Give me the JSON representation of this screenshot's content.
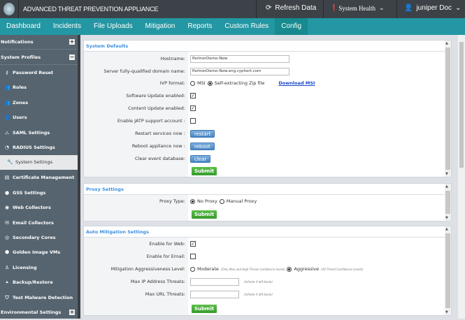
{
  "header": {
    "title": "ADVANCED THREAT PREVENTION APPLIANCE",
    "refresh": "Refresh Data",
    "health": "System Health",
    "user": "juniper Doc"
  },
  "nav": [
    "Dashboard",
    "Incidents",
    "File Uploads",
    "Mitigation",
    "Reports",
    "Custom Rules",
    "Config"
  ],
  "sidebar": {
    "notifications": "Notifications",
    "system_profiles": "System Profiles",
    "environmental": "Environmental Settings",
    "items": [
      "Password Reset",
      "Roles",
      "Zones",
      "Users",
      "SAML Settings",
      "RADIUS Settings",
      "System Settings",
      "Certificate Management",
      "GSS Settings",
      "Web Collectors",
      "Email Collectors",
      "Secondary Cores",
      "Golden Image VMs",
      "Licensing",
      "Backup/Restore",
      "Test Malware Detection"
    ]
  },
  "system_defaults": {
    "title": "System Defaults",
    "hostname_label": "Hostname:",
    "hostname": "PartnerDemo-New",
    "fqdn_label": "Server fully-qualified domain name:",
    "fqdn": "PartnerDemo-New.eng.cyphort.com",
    "ivp_label": "IVP format:",
    "ivp_msi": "MSI",
    "ivp_zip": "Self-extracting Zip file",
    "download": "Download MSI",
    "sw_label": "Software Update enabled:",
    "content_label": "Content Update enabled:",
    "jatp_label": "Enable JATP support account :",
    "restart_label": "Restart services now :",
    "restart": "restart",
    "reboot_label": "Reboot appliance now :",
    "reboot": "reboot",
    "clear_label": "Clear event database:",
    "clear": "clear",
    "submit": "Submit"
  },
  "proxy": {
    "title": "Proxy Settings",
    "type_label": "Proxy Type:",
    "no_proxy": "No Proxy",
    "manual": "Manual Proxy",
    "submit": "Submit"
  },
  "mitigation": {
    "title": "Auto Mitigation Settings",
    "web_label": "Enable for Web:",
    "email_label": "Enable for Email:",
    "level_label": "Mitigation Aggressiveness Level:",
    "moderate": "Moderate",
    "moderate_hint": "(Only Max and High Threat confidence levels)",
    "aggressive": "Aggressive",
    "aggressive_hint": "(All Threat Confidence Levels)",
    "ip_label": "Max IP Address Threats:",
    "url_label": "Max URL Threats:",
    "blank_hint": "(Infinite if left blank)",
    "submit": "Submit"
  }
}
